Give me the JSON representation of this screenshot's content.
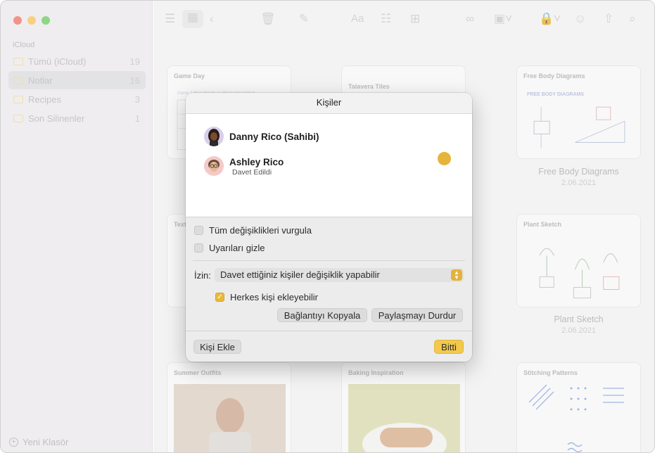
{
  "sidebar": {
    "section": "iCloud",
    "items": [
      {
        "label": "Tümü (iCloud)",
        "count": "19"
      },
      {
        "label": "Notlar",
        "count": "16"
      },
      {
        "label": "Recipes",
        "count": "3"
      },
      {
        "label": "Son Silinenler",
        "count": "1"
      }
    ],
    "new_folder": "Yeni Klasör"
  },
  "notes": {
    "game_day": "Game Day",
    "talavera": "Talavera Tiles",
    "fbd_card": "Free Body Diagrams",
    "fbd_caption": "Free Body Diagrams",
    "fbd_date": "2.06.2021",
    "text_card": "Text",
    "plant_card": "Plant Sketch",
    "plant_caption": "Plant Sketch",
    "plant_date": "2.06.2021",
    "summer": "Summer Outfits",
    "baking": "Baking Inspiration",
    "stitching": "Stitching Patterns",
    "game_day_sketch_line": "Game 3 Blue Streak vs Manzanita United",
    "fbd_sketch_title": "FREE BODY DIAGRAMS"
  },
  "dialog": {
    "title": "Kişiler",
    "people": [
      {
        "name": "Danny Rico (Sahibi)"
      },
      {
        "name": "Ashley Rico",
        "status": "Davet Edildi"
      }
    ],
    "presence_color": "#e5b43b",
    "highlight_changes": "Tüm değişiklikleri vurgula",
    "hide_alerts": "Uyarıları gizle",
    "permission_label": "İzin:",
    "permission_value": "Davet ettiğiniz kişiler değişiklik yapabilir",
    "anyone_add": "Herkes kişi ekleyebilir",
    "copy_link": "Bağlantıyı Kopyala",
    "stop_sharing": "Paylaşmayı Durdur",
    "add_people": "Kişi Ekle",
    "done": "Bitti",
    "accent_color": "#f2c94c"
  }
}
